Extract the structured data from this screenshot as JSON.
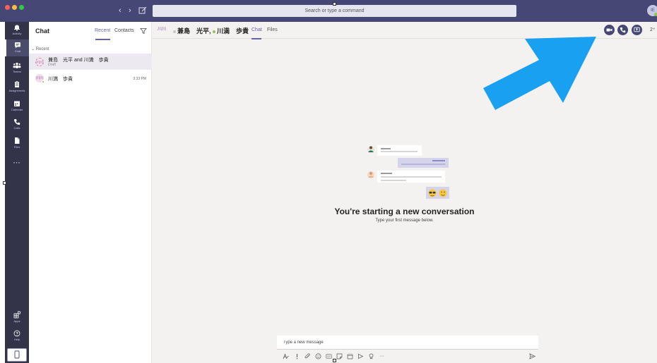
{
  "colors": {
    "titlebar": "#464775",
    "rail": "#33344a",
    "accent": "#6264a7",
    "presence_available": "#92c353",
    "arrow": "#1aa0f0"
  },
  "window": {
    "search_placeholder": "Search or type a command",
    "me_initials": "IE"
  },
  "rail": {
    "items": [
      {
        "label": "Activity",
        "icon": "bell-icon"
      },
      {
        "label": "Chat",
        "icon": "chat-icon"
      },
      {
        "label": "Teams",
        "icon": "teams-icon"
      },
      {
        "label": "Assignments",
        "icon": "assignments-icon"
      },
      {
        "label": "Calendar",
        "icon": "calendar-icon"
      },
      {
        "label": "Calls",
        "icon": "phone-icon"
      },
      {
        "label": "Files",
        "icon": "file-icon"
      }
    ],
    "more": "···",
    "apps_label": "Apps",
    "help_label": "Help"
  },
  "chat_list": {
    "title": "Chat",
    "tabs": {
      "recent": "Recent",
      "contacts": "Contacts"
    },
    "section_label": "Recent",
    "items": [
      {
        "avatar": "川川",
        "name": "兼島　光平 and 川満　歩貴",
        "sub": "Draft",
        "time": ""
      },
      {
        "avatar": "川川",
        "name": "川満　歩貴",
        "sub": "",
        "time": "3:33 PM"
      }
    ]
  },
  "conversation": {
    "header_avatar": "川川",
    "participant_1": "兼島　光平,",
    "participant_2": "川満　歩貴",
    "tabs": {
      "chat": "Chat",
      "files": "Files"
    },
    "add_people_label": "2⁺",
    "empty_title": "You're starting a new conversation",
    "empty_subtitle": "Type your first message below.",
    "compose_placeholder": "Type a new message"
  }
}
